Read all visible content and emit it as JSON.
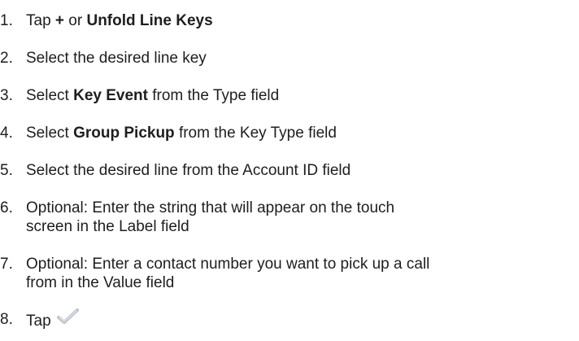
{
  "steps": [
    {
      "num": "1.",
      "parts": [
        "Tap ",
        "+",
        " or  ",
        "Unfold Line Keys",
        ""
      ]
    },
    {
      "num": "2.",
      "text": "Select the desired line key"
    },
    {
      "num": "3.",
      "parts": [
        "Select ",
        "Key Event",
        " from the Type field"
      ]
    },
    {
      "num": "4.",
      "parts": [
        "Select ",
        "Group Pickup",
        " from the Key Type field"
      ]
    },
    {
      "num": "5.",
      "text": "Select the desired line from the Account ID field"
    },
    {
      "num": "6.",
      "lines": [
        "Optional: Enter the string that will appear on the touch",
        "screen in the Label field"
      ]
    },
    {
      "num": "7.",
      "lines": [
        "Optional: Enter a contact number you want to pick up a call",
        "from in the Value field"
      ]
    },
    {
      "num": "8.",
      "text": "Tap",
      "icon": "checkmark-icon"
    }
  ],
  "colors": {
    "text": "#1e1e1e",
    "checkmark": "#b8c3cc"
  }
}
